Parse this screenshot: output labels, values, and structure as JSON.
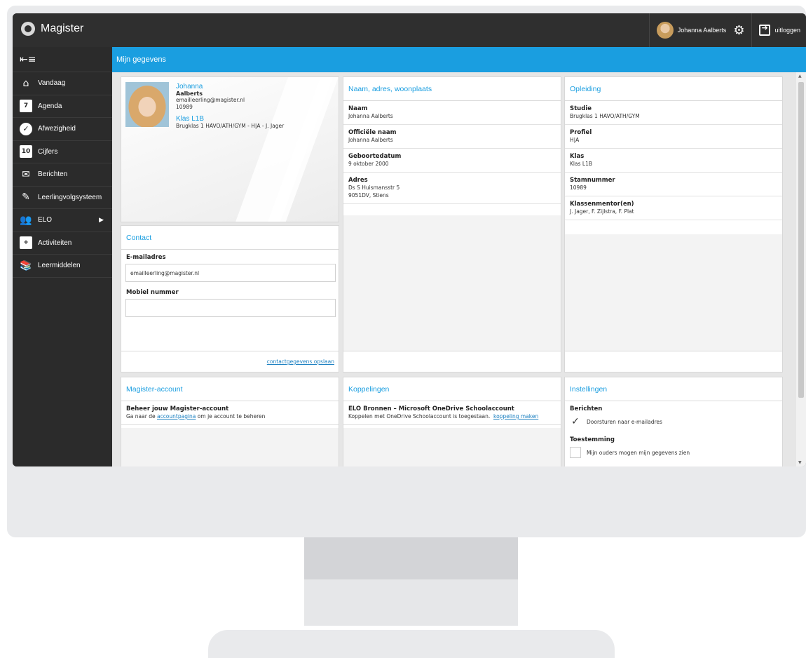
{
  "app": {
    "name": "Magister"
  },
  "topbar": {
    "user_name": "Johanna Aalberts",
    "logout_label": "uitloggen"
  },
  "sidebar": {
    "collapse_icon": "collapse-menu-icon",
    "items": [
      {
        "label": "Vandaag",
        "icon": "home-icon"
      },
      {
        "label": "Agenda",
        "icon": "calendar-icon",
        "icon_text": "7"
      },
      {
        "label": "Afwezigheid",
        "icon": "check-icon"
      },
      {
        "label": "Cijfers",
        "icon": "grade-icon",
        "icon_text": "10"
      },
      {
        "label": "Berichten",
        "icon": "envelope-icon"
      },
      {
        "label": "Leerlingvolgsysteem",
        "icon": "notebook-icon"
      },
      {
        "label": "ELO",
        "icon": "group-icon"
      },
      {
        "label": "Activiteiten",
        "icon": "calendar-plus-icon"
      },
      {
        "label": "Leermiddelen",
        "icon": "books-icon"
      }
    ]
  },
  "page": {
    "title": "Mijn gegevens"
  },
  "profile": {
    "first_name": "Johanna",
    "last_name": "Aalberts",
    "email": "emailleerling@magister.nl",
    "student_number": "10989",
    "klas": "Klas L1B",
    "klas_detail": "Brugklas 1 HAVO/ATH/GYM - H|A - J. Jager"
  },
  "contact": {
    "title": "Contact",
    "email_label": "E-mailadres",
    "email_value": "emailleerling@magister.nl",
    "mobile_label": "Mobiel nummer",
    "mobile_value": "",
    "save_link": "contactgegevens opslaan"
  },
  "naam_panel": {
    "title": "Naam, adres, woonplaats",
    "rows": [
      {
        "label": "Naam",
        "lines": [
          "Johanna Aalberts"
        ]
      },
      {
        "label": "Officiële naam",
        "lines": [
          "Johanna Aalberts"
        ]
      },
      {
        "label": "Geboortedatum",
        "lines": [
          "9 oktober 2000"
        ]
      },
      {
        "label": "Adres",
        "lines": [
          "Ds S Huismansstr 5",
          "9051DV, Stiens"
        ]
      }
    ]
  },
  "opleiding_panel": {
    "title": "Opleiding",
    "rows": [
      {
        "label": "Studie",
        "lines": [
          "Brugklas 1 HAVO/ATH/GYM"
        ]
      },
      {
        "label": "Profiel",
        "lines": [
          "H|A"
        ]
      },
      {
        "label": "Klas",
        "lines": [
          "Klas L1B"
        ]
      },
      {
        "label": "Stamnummer",
        "lines": [
          "10989"
        ]
      },
      {
        "label": "Klassenmentor(en)",
        "lines": [
          "J. Jager,  F. Zijlstra,  F. Plat"
        ]
      }
    ]
  },
  "account_panel": {
    "title": "Magister-account",
    "heading": "Beheer jouw Magister-account",
    "text_before": "Ga naar de ",
    "link": "accountpagina",
    "text_after": " om je account te beheren"
  },
  "koppel_panel": {
    "title": "Koppelingen",
    "heading": "ELO Bronnen – Microsoft OneDrive Schoolaccount",
    "text": "Koppelen met OneDrive Schoolaccount is toegestaan.",
    "link": "koppeling maken"
  },
  "instel_panel": {
    "title": "Instellingen",
    "berichten_label": "Berichten",
    "forward_label": "Doorsturen naar e-mailadres",
    "forward_checked": true,
    "toestemming_label": "Toestemming",
    "parents_label": "Mijn ouders mogen mijn gegevens zien",
    "parents_checked": false
  },
  "colors": {
    "accent": "#1a9ee0",
    "sidebar": "#2b2b2b",
    "topbar": "#2f2f2f"
  }
}
